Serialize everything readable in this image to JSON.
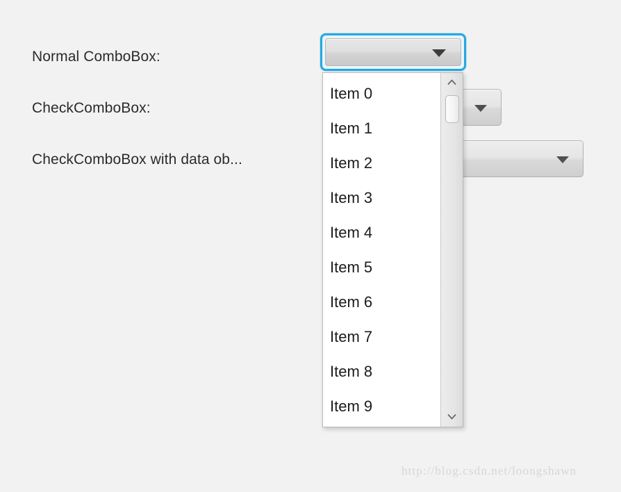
{
  "window": {
    "background_color": "#f2f2f2"
  },
  "rows": [
    {
      "label": "Normal ComboBox:"
    },
    {
      "label": "CheckComboBox:"
    },
    {
      "label": "CheckComboBox with data ob..."
    }
  ],
  "combo_normal": {
    "value": "",
    "focused": true,
    "focus_ring_color": "#25a8e0",
    "arrow_icon": "chevron-down-icon"
  },
  "combo_check": {
    "value": "",
    "arrow_icon": "chevron-down-icon"
  },
  "combo_check_data": {
    "value": "",
    "arrow_icon": "chevron-down-icon"
  },
  "dropdown": {
    "open": true,
    "items": [
      "Item 0",
      "Item 1",
      "Item 2",
      "Item 3",
      "Item 4",
      "Item 5",
      "Item 6",
      "Item 7",
      "Item 8",
      "Item 9"
    ],
    "scrollbar": {
      "up_icon": "chevron-up-icon",
      "down_icon": "chevron-down-icon",
      "thumb_position_percent": 6
    }
  },
  "watermark": {
    "text": "http://blog.csdn.net/loongshawn"
  }
}
